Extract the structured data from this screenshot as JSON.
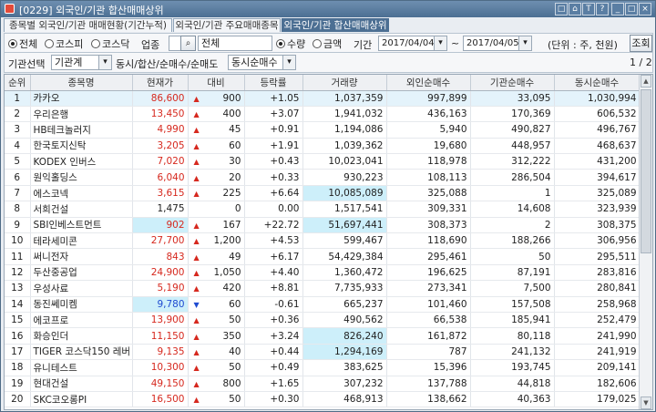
{
  "window": {
    "title": "[0229] 외국인/기관 합산매매상위",
    "controls": [
      "□",
      "⌂",
      "T",
      "?",
      "_",
      "□",
      "×"
    ]
  },
  "tabs": [
    {
      "label": "종목별 외국인/기관 매매현황(기간누적)",
      "active": false
    },
    {
      "label": "외국인/기관 주요매매종목",
      "active": false
    },
    {
      "label": "외국인/기관 합산매매상위",
      "active": true
    }
  ],
  "filters": {
    "market": {
      "options": [
        "전체",
        "코스피",
        "코스닥"
      ],
      "selected": "전체"
    },
    "industry_label": "업종",
    "industry_value": "전체",
    "basis": {
      "options": [
        "수량",
        "금액"
      ],
      "selected": "수량"
    },
    "period_label": "기간",
    "date_from": "2017/04/04",
    "date_sep": "~",
    "date_to": "2017/04/05",
    "unit": "(단위 : 주, 천원)",
    "search_button": "조회",
    "investor_label": "기관선택",
    "investor_value": "기관계",
    "sort_label": "동시/합산/순매수/순매도",
    "sort_value": "동시순매수",
    "page": "1 / 2"
  },
  "table": {
    "columns": [
      "순위",
      "종목명",
      "현재가",
      "대비",
      "등락률",
      "거래량",
      "외인순매수",
      "기관순매수",
      "동시순매수"
    ],
    "rows": [
      {
        "rank": "1",
        "name": "카카오",
        "price": "86,600",
        "dir": "up",
        "change": "900",
        "rate": "+1.05",
        "volume": "1,037,359",
        "foreign": "997,899",
        "inst": "33,095",
        "both": "1,030,994",
        "sel": true
      },
      {
        "rank": "2",
        "name": "우리은행",
        "price": "13,450",
        "dir": "up",
        "change": "400",
        "rate": "+3.07",
        "volume": "1,941,032",
        "foreign": "436,163",
        "inst": "170,369",
        "both": "606,532"
      },
      {
        "rank": "3",
        "name": "HB테크놀러지",
        "price": "4,990",
        "dir": "up",
        "change": "45",
        "rate": "+0.91",
        "volume": "1,194,086",
        "foreign": "5,940",
        "inst": "490,827",
        "both": "496,767"
      },
      {
        "rank": "4",
        "name": "한국토지신탁",
        "price": "3,205",
        "dir": "up",
        "change": "60",
        "rate": "+1.91",
        "volume": "1,039,362",
        "foreign": "19,680",
        "inst": "448,957",
        "both": "468,637"
      },
      {
        "rank": "5",
        "name": "KODEX 인버스",
        "price": "7,020",
        "dir": "up",
        "change": "30",
        "rate": "+0.43",
        "volume": "10,023,041",
        "foreign": "118,978",
        "inst": "312,222",
        "both": "431,200"
      },
      {
        "rank": "6",
        "name": "원익홀딩스",
        "price": "6,040",
        "dir": "up",
        "change": "20",
        "rate": "+0.33",
        "volume": "930,223",
        "foreign": "108,113",
        "inst": "286,504",
        "both": "394,617"
      },
      {
        "rank": "7",
        "name": "에스코넥",
        "price": "3,615",
        "dir": "up",
        "change": "225",
        "rate": "+6.64",
        "volume": "10,085,089",
        "foreign": "325,088",
        "inst": "1",
        "both": "325,089",
        "hl_volume": true
      },
      {
        "rank": "8",
        "name": "서희건설",
        "price": "1,475",
        "dir": "none",
        "change": "0",
        "rate": "0.00",
        "volume": "1,517,541",
        "foreign": "309,331",
        "inst": "14,608",
        "both": "323,939"
      },
      {
        "rank": "9",
        "name": "SBI인베스트먼트",
        "price": "902",
        "dir": "up",
        "change": "167",
        "rate": "+22.72",
        "volume": "51,697,441",
        "foreign": "308,373",
        "inst": "2",
        "both": "308,375",
        "hl_price": true,
        "hl_volume": true
      },
      {
        "rank": "10",
        "name": "테라세미콘",
        "price": "27,700",
        "dir": "up",
        "change": "1,200",
        "rate": "+4.53",
        "volume": "599,467",
        "foreign": "118,690",
        "inst": "188,266",
        "both": "306,956"
      },
      {
        "rank": "11",
        "name": "써니전자",
        "price": "843",
        "dir": "up",
        "change": "49",
        "rate": "+6.17",
        "volume": "54,429,384",
        "foreign": "295,461",
        "inst": "50",
        "both": "295,511"
      },
      {
        "rank": "12",
        "name": "두산중공업",
        "price": "24,900",
        "dir": "up",
        "change": "1,050",
        "rate": "+4.40",
        "volume": "1,360,472",
        "foreign": "196,625",
        "inst": "87,191",
        "both": "283,816"
      },
      {
        "rank": "13",
        "name": "우성사료",
        "price": "5,190",
        "dir": "up",
        "change": "420",
        "rate": "+8.81",
        "volume": "7,735,933",
        "foreign": "273,341",
        "inst": "7,500",
        "both": "280,841"
      },
      {
        "rank": "14",
        "name": "동진쎄미켐",
        "price": "9,780",
        "dir": "down",
        "change": "60",
        "rate": "-0.61",
        "volume": "665,237",
        "foreign": "101,460",
        "inst": "157,508",
        "both": "258,968",
        "hl_price": true
      },
      {
        "rank": "15",
        "name": "에코프로",
        "price": "13,900",
        "dir": "up",
        "change": "50",
        "rate": "+0.36",
        "volume": "490,562",
        "foreign": "66,538",
        "inst": "185,941",
        "both": "252,479"
      },
      {
        "rank": "16",
        "name": "화승인더",
        "price": "11,150",
        "dir": "up",
        "change": "350",
        "rate": "+3.24",
        "volume": "826,240",
        "foreign": "161,872",
        "inst": "80,118",
        "both": "241,990",
        "hl_volume": true
      },
      {
        "rank": "17",
        "name": "TIGER 코스닥150 레버",
        "price": "9,135",
        "dir": "up",
        "change": "40",
        "rate": "+0.44",
        "volume": "1,294,169",
        "foreign": "787",
        "inst": "241,132",
        "both": "241,919",
        "hl_volume": true
      },
      {
        "rank": "18",
        "name": "유니테스트",
        "price": "10,300",
        "dir": "up",
        "change": "50",
        "rate": "+0.49",
        "volume": "383,625",
        "foreign": "15,396",
        "inst": "193,745",
        "both": "209,141"
      },
      {
        "rank": "19",
        "name": "현대건설",
        "price": "49,150",
        "dir": "up",
        "change": "800",
        "rate": "+1.65",
        "volume": "307,232",
        "foreign": "137,788",
        "inst": "44,818",
        "both": "182,606"
      },
      {
        "rank": "20",
        "name": "SKC코오롱PI",
        "price": "16,500",
        "dir": "up",
        "change": "50",
        "rate": "+0.30",
        "volume": "468,913",
        "foreign": "138,662",
        "inst": "40,363",
        "both": "179,025"
      }
    ]
  },
  "colors": {
    "up": "#d6281e",
    "down": "#1f4bd1",
    "accent": "#4c6f93",
    "highlight": "#cdeffa"
  }
}
